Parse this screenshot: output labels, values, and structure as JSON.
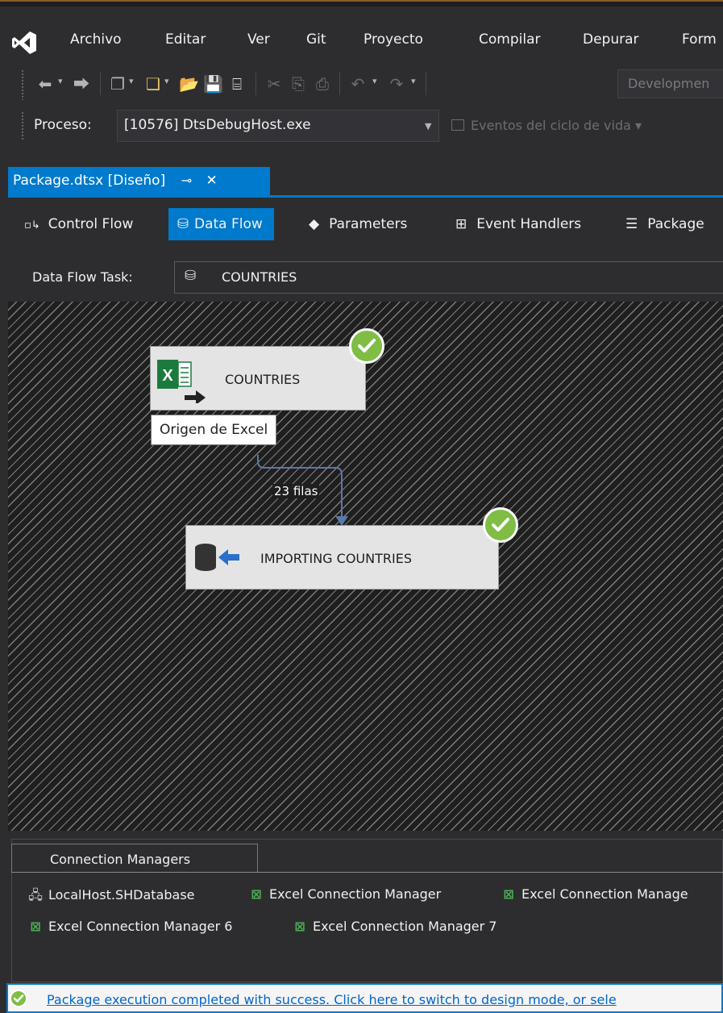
{
  "menu": {
    "items": [
      "Archivo",
      "Editar",
      "Ver",
      "Git",
      "Proyecto",
      "Compilar",
      "Depurar",
      "Form"
    ]
  },
  "toolbar": {
    "configuration": "Developmen"
  },
  "process": {
    "label": "Proceso:",
    "value": "[10576] DtsDebugHost.exe",
    "lifecycle": "Eventos del ciclo de vida"
  },
  "document_tab": {
    "title": "Package.dtsx [Diseño]",
    "pin_glyph": "⊸",
    "close_glyph": "✕"
  },
  "designer_tabs": [
    {
      "label": "Control Flow",
      "icon": "control-flow-icon"
    },
    {
      "label": "Data Flow",
      "icon": "data-flow-icon",
      "active": true
    },
    {
      "label": "Parameters",
      "icon": "parameters-icon"
    },
    {
      "label": "Event Handlers",
      "icon": "event-handlers-icon"
    },
    {
      "label": "Package",
      "icon": "package-explorer-icon"
    }
  ],
  "data_flow_task": {
    "label": "Data Flow Task:",
    "value": "COUNTRIES"
  },
  "canvas": {
    "source": {
      "name": "COUNTRIES",
      "icon": "excel-source-icon",
      "status": "success"
    },
    "tooltip": "Origen de Excel",
    "path_label": "23 filas",
    "destination": {
      "name": "IMPORTING COUNTRIES",
      "icon": "ole-db-destination-icon",
      "status": "success"
    }
  },
  "connection_managers": {
    "title": "Connection Managers",
    "items": [
      {
        "label": "LocalHost.SHDatabase",
        "icon": "database-connection-icon"
      },
      {
        "label": "Excel Connection Manager",
        "icon": "excel-connection-icon"
      },
      {
        "label": "Excel Connection Manage",
        "icon": "excel-connection-icon"
      },
      {
        "label": "Excel Connection Manager 6",
        "icon": "excel-connection-icon"
      },
      {
        "label": "Excel Connection Manager 7",
        "icon": "excel-connection-icon"
      }
    ]
  },
  "status": {
    "text": "Package execution completed with success. Click here to switch to design mode, or sele"
  },
  "colors": {
    "accent": "#007acc",
    "success": "#7fbd45",
    "background": "#2d2d30"
  }
}
